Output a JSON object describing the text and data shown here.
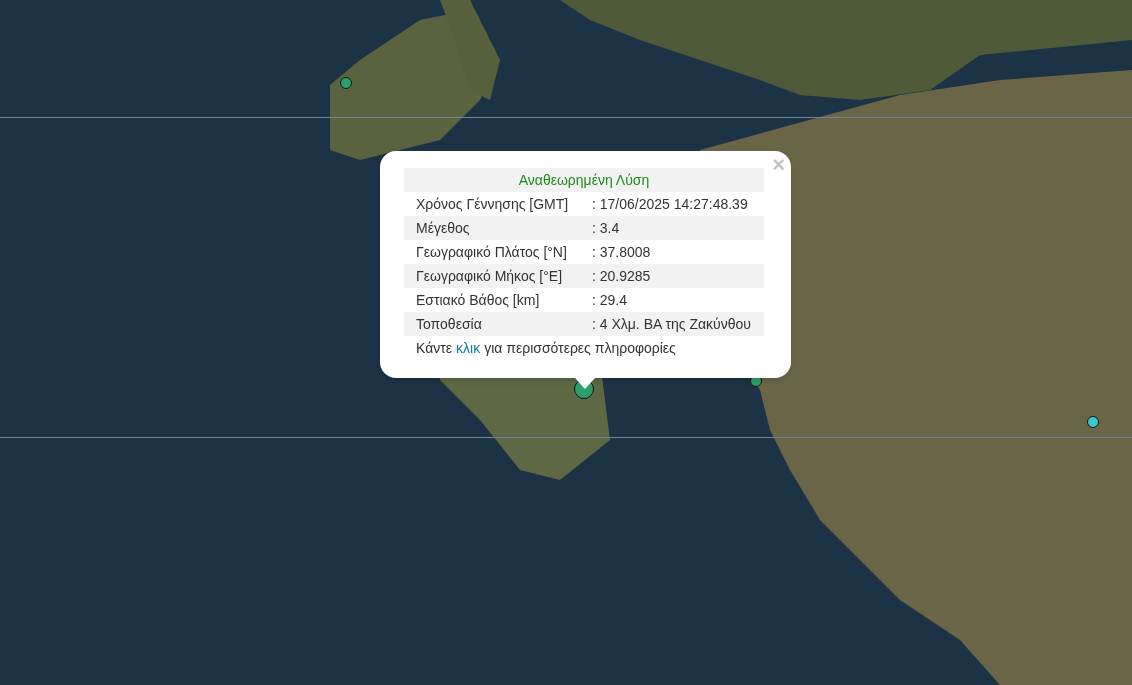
{
  "map": {
    "markers": [
      {
        "color": "#2e9e6a",
        "selected": false
      },
      {
        "color": "#2e9e6a",
        "selected": true
      },
      {
        "color": "#2e9e6a",
        "selected": false
      },
      {
        "color": "#3cc8d0",
        "selected": false
      }
    ]
  },
  "popup": {
    "close": "×",
    "title": "Αναθεωρημένη Λύση",
    "rows": [
      {
        "label": "Χρόνος Γέννησης [GMT]",
        "value": ": 17/06/2025 14:27:48.39"
      },
      {
        "label": "Μέγεθος",
        "value": ": 3.4"
      },
      {
        "label": "Γεωγραφικό Πλάτος [°N]",
        "value": ": 37.8008"
      },
      {
        "label": "Γεωγραφικό Μήκος [°E]",
        "value": ": 20.9285"
      },
      {
        "label": "Εστιακό Βάθος [km]",
        "value": ": 29.4"
      },
      {
        "label": "Τοποθεσία",
        "value": ": 4 Χλμ. ΒΑ της Ζακύνθου"
      }
    ],
    "footer": {
      "before": "Κάντε",
      "link": "κλικ",
      "after": "για περισσότερες πληροφορίες"
    }
  }
}
